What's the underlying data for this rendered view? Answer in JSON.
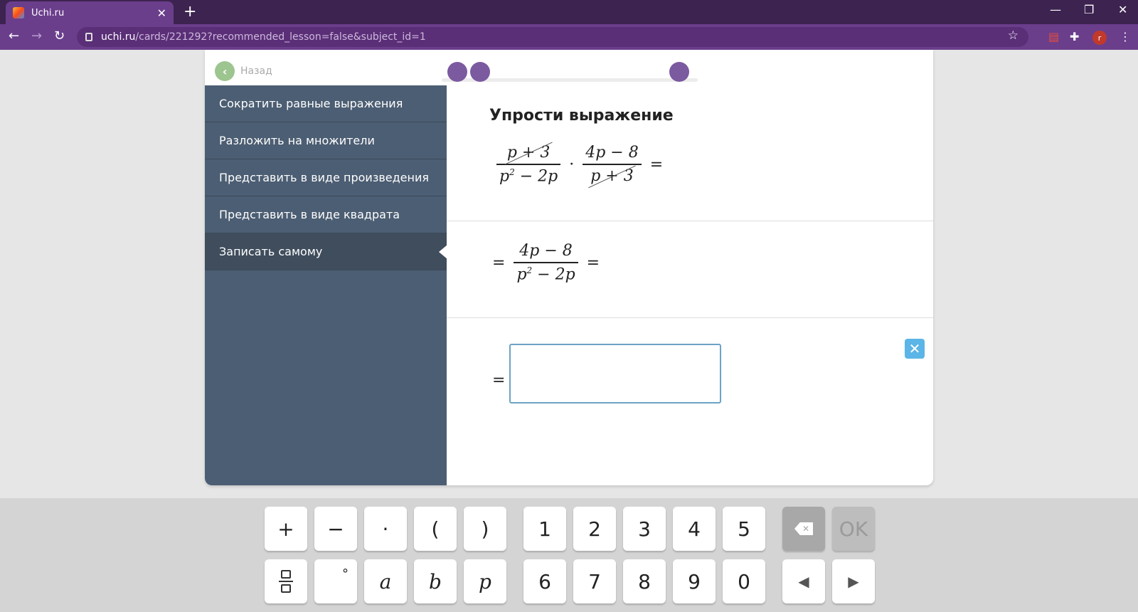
{
  "browser": {
    "tab_title": "Uchi.ru",
    "tab_close": "✕",
    "new_tab": "+",
    "minimize": "—",
    "restore": "❐",
    "close": "✕",
    "url_host": "uchi.ru",
    "url_path": "/cards/221292?recommended_lesson=false&subject_id=1",
    "profile_initial": "r"
  },
  "card": {
    "back_label": "Назад",
    "task_title": "Упрости выражение",
    "menu": [
      {
        "label": "Сократить равные выражения"
      },
      {
        "label": "Разложить на множители"
      },
      {
        "label": "Представить в виде произведения"
      },
      {
        "label": "Представить в виде квадрата"
      },
      {
        "label": "Записать самому"
      }
    ],
    "step1": {
      "frac1_num": "p + 3",
      "frac1_den_base": "p",
      "frac1_den_exp": "2",
      "frac1_den_rest": " − 2p",
      "op": "·",
      "frac2_num": "4p − 8",
      "frac2_den": "p + 3",
      "eq": "="
    },
    "step2": {
      "eq_left": "=",
      "num": "4p − 8",
      "den_base": "p",
      "den_exp": "2",
      "den_rest": " − 2p",
      "eq_right": "="
    },
    "answer": {
      "eq": "=",
      "value": "",
      "clear_label": "✕"
    }
  },
  "keyboard": {
    "row1_ops": [
      "+",
      "−",
      "·",
      "(",
      ")"
    ],
    "row1_digits": [
      "1",
      "2",
      "3",
      "4",
      "5"
    ],
    "row2_vars": [
      "°",
      "a",
      "b",
      "p"
    ],
    "row2_digits": [
      "6",
      "7",
      "8",
      "9",
      "0"
    ],
    "ok_label": "OK",
    "left_arrow": "◀",
    "right_arrow": "▶"
  },
  "colors": {
    "brand": "#6b3e8c",
    "sidebar": "#4c5e73",
    "progress_dot": "#7b5aa0"
  }
}
